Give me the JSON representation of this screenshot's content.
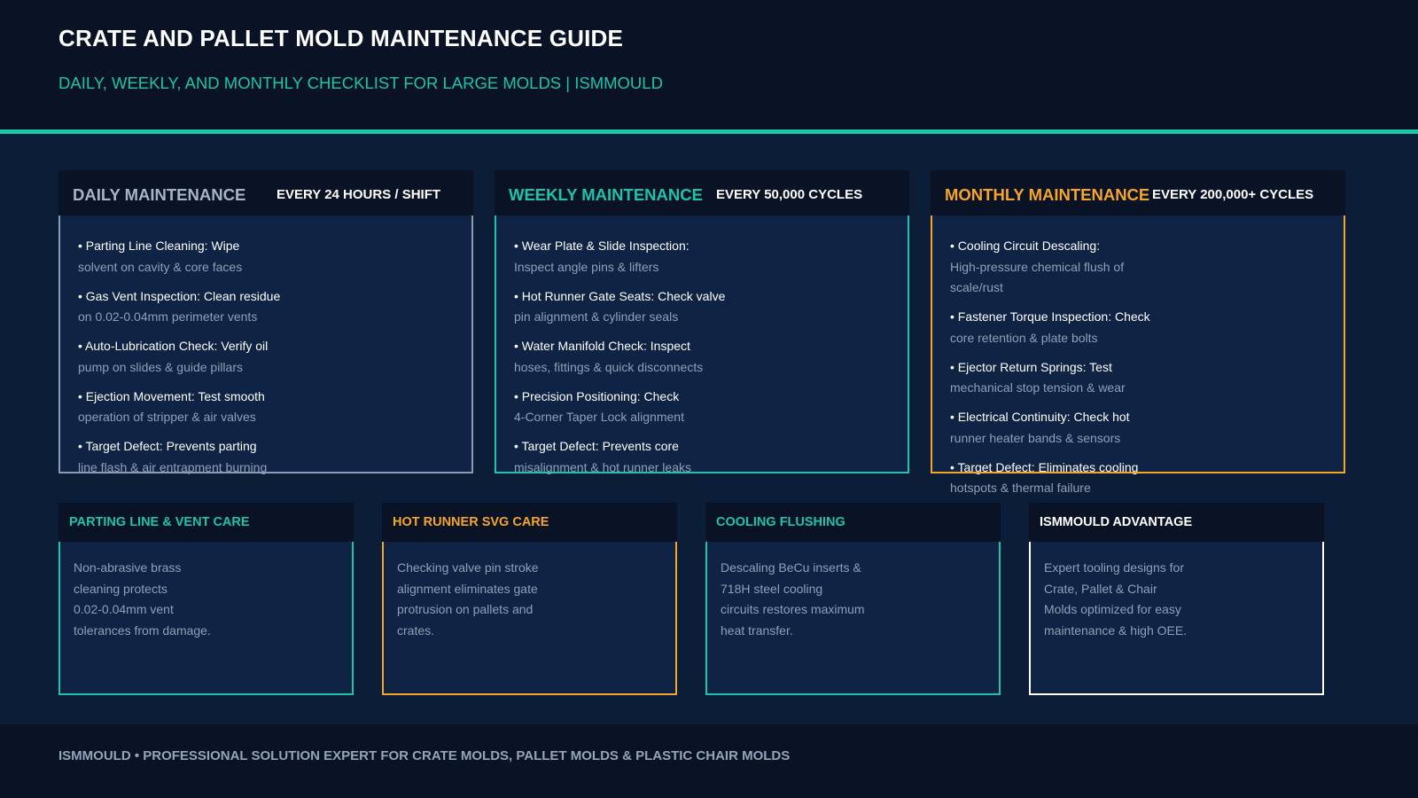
{
  "header": {
    "title": "CRATE AND PALLET MOLD MAINTENANCE GUIDE",
    "subtitle": "DAILY, WEEKLY, AND MONTHLY CHECKLIST FOR LARGE MOLDS | ISMMOULD"
  },
  "colors": {
    "background": "#0c1d38",
    "header_bg": "#0a1325",
    "teal": "#1ec3aa",
    "orange": "#f5a42c",
    "grey_blue": "#8a9cb6",
    "muted_text": "#8ea0b8"
  },
  "maintenance": {
    "daily": {
      "name": "DAILY MAINTENANCE",
      "frequency": "EVERY 24 HOURS / SHIFT",
      "items": [
        {
          "title": "• Parting Line Cleaning: Wipe",
          "desc": "solvent on cavity & core faces"
        },
        {
          "title": "• Gas Vent Inspection: Clean residue",
          "desc": "on 0.02-0.04mm perimeter vents"
        },
        {
          "title": "• Auto-Lubrication Check: Verify oil",
          "desc": "pump on slides & guide pillars"
        },
        {
          "title": "• Ejection Movement: Test smooth",
          "desc": "operation of stripper & air valves"
        },
        {
          "title": "• Target Defect: Prevents parting",
          "desc": "line flash & air entrapment burning"
        }
      ]
    },
    "weekly": {
      "name": "WEEKLY MAINTENANCE",
      "frequency": "EVERY 50,000 CYCLES",
      "items": [
        {
          "title": "• Wear Plate & Slide Inspection:",
          "desc": "Inspect angle pins & lifters"
        },
        {
          "title": "• Hot Runner Gate Seats: Check valve",
          "desc": "pin alignment & cylinder seals"
        },
        {
          "title": "• Water Manifold Check: Inspect",
          "desc": "hoses, fittings & quick disconnects"
        },
        {
          "title": "• Precision Positioning: Check",
          "desc": "4-Corner Taper Lock alignment"
        },
        {
          "title": "• Target Defect: Prevents core",
          "desc": "misalignment & hot runner leaks"
        }
      ]
    },
    "monthly": {
      "name": "MONTHLY MAINTENANCE",
      "frequency": "EVERY 200,000+ CYCLES",
      "items": [
        {
          "title": "• Cooling Circuit Descaling:",
          "desc": "High-pressure chemical flush of\nscale/rust"
        },
        {
          "title": "• Fastener Torque Inspection: Check",
          "desc": "core retention & plate bolts"
        },
        {
          "title": "• Ejector Return Springs: Test",
          "desc": "mechanical stop tension & wear"
        },
        {
          "title": "• Electrical Continuity: Check hot",
          "desc": "runner heater bands & sensors"
        },
        {
          "title": "• Target Defect: Eliminates cooling",
          "desc": "hotspots & thermal failure"
        }
      ]
    }
  },
  "cards": [
    {
      "title": "PARTING LINE & VENT CARE",
      "body": "Non-abrasive brass\ncleaning protects\n0.02-0.04mm vent\ntolerances from damage."
    },
    {
      "title": "HOT RUNNER SVG CARE",
      "body": "Checking valve pin stroke\nalignment eliminates gate\nprotrusion on pallets and\ncrates."
    },
    {
      "title": "COOLING FLUSHING",
      "body": "Descaling BeCu inserts &\n718H steel cooling\ncircuits restores maximum\nheat transfer."
    },
    {
      "title": "ISMMOULD ADVANTAGE",
      "body": "Expert tooling designs for\nCrate, Pallet & Chair\nMolds optimized for easy\nmaintenance & high OEE."
    }
  ],
  "footer": {
    "text": "ISMMOULD • PROFESSIONAL SOLUTION EXPERT FOR CRATE MOLDS, PALLET MOLDS & PLASTIC CHAIR MOLDS"
  }
}
